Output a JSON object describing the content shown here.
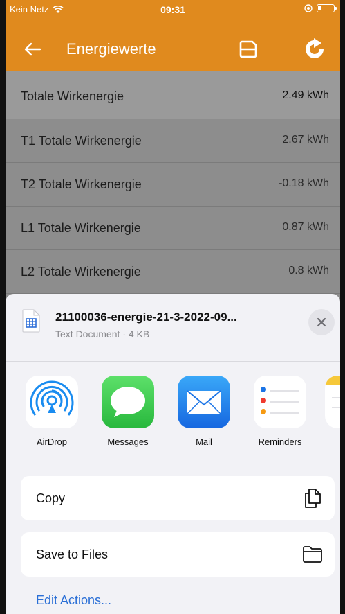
{
  "status": {
    "carrier": "Kein Netz",
    "time": "09:31"
  },
  "nav": {
    "title": "Energiewerte"
  },
  "readings": [
    {
      "label": "Totale Wirkenergie",
      "value": "2.49 kWh"
    },
    {
      "label": "T1 Totale Wirkenergie",
      "value": "2.67 kWh"
    },
    {
      "label": "T2 Totale Wirkenergie",
      "value": "-0.18 kWh"
    },
    {
      "label": "L1 Totale Wirkenergie",
      "value": "0.87 kWh"
    },
    {
      "label": "L2 Totale Wirkenergie",
      "value": "0.8 kWh"
    }
  ],
  "share": {
    "file_name": "21100036-energie-21-3-2022-09...",
    "file_meta": "Text Document · 4 KB",
    "apps": [
      {
        "name": "AirDrop",
        "icon": "airdrop-icon"
      },
      {
        "name": "Messages",
        "icon": "messages-icon"
      },
      {
        "name": "Mail",
        "icon": "mail-icon"
      },
      {
        "name": "Reminders",
        "icon": "reminders-icon"
      }
    ],
    "actions": [
      {
        "label": "Copy",
        "icon": "copy-icon"
      },
      {
        "label": "Save to Files",
        "icon": "folder-icon"
      }
    ],
    "edit_actions": "Edit Actions..."
  },
  "colors": {
    "accent": "#e08a1e",
    "link": "#2a6fd6"
  }
}
